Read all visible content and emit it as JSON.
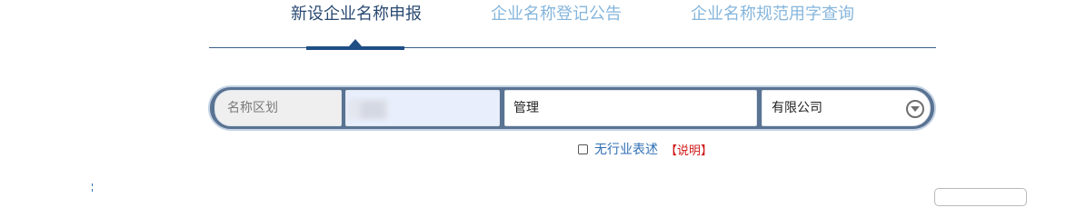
{
  "tabs": [
    {
      "label": "新设企业名称申报",
      "active": true
    },
    {
      "label": "企业名称登记公告",
      "active": false
    },
    {
      "label": "企业名称规范用字查询",
      "active": false
    }
  ],
  "search": {
    "region_placeholder": "名称区划",
    "mark_value": "",
    "industry_value": "管理",
    "org_form_value": "有限公司",
    "org_form_icon": "chevron-down-circle-icon"
  },
  "options": {
    "no_industry_label": "无行业表述",
    "no_industry_checked": false,
    "explain_link": "【说明】"
  },
  "colors": {
    "active_tab": "#2a4a72",
    "inactive_tab": "#86b6dc",
    "accent": "#1f4e85",
    "search_bar_bg": "#5a7393",
    "link": "#2f6fb5",
    "explain": "#d01818"
  }
}
